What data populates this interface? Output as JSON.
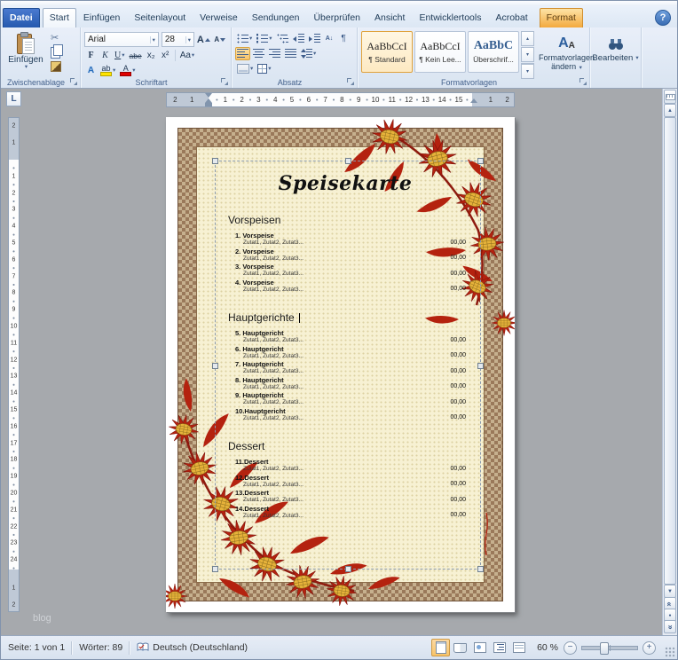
{
  "window": {
    "help": "?"
  },
  "icons": {
    "dropdown": "▾",
    "cut": "✂",
    "pilcrow": "¶",
    "sort": "A↓",
    "scroll_up": "▲",
    "scroll_down": "▼",
    "gallery_up": "▴",
    "gallery_down": "▾",
    "double_chevron": "«",
    "dot": "●",
    "style_a": "A",
    "minus": "−",
    "plus": "+",
    "tab_selector": "L"
  },
  "ribbon": {
    "tabs": [
      {
        "label": "Datei",
        "file": true
      },
      {
        "label": "Start",
        "active": true
      },
      {
        "label": "Einfügen"
      },
      {
        "label": "Seitenlayout"
      },
      {
        "label": "Verweise"
      },
      {
        "label": "Sendungen"
      },
      {
        "label": "Überprüfen"
      },
      {
        "label": "Ansicht"
      },
      {
        "label": "Entwicklertools"
      },
      {
        "label": "Acrobat"
      },
      {
        "label": "Format",
        "contextual": true
      }
    ],
    "clipboard": {
      "group": "Zwischenablage",
      "paste": "Einfügen"
    },
    "font": {
      "group": "Schriftart",
      "name": "Arial",
      "size": "28",
      "bold": "F",
      "italic": "K",
      "underline": "U",
      "strike": "abe",
      "sub": "x₂",
      "sup": "x²",
      "case": "Aa",
      "effects": "A",
      "highlight": "ab",
      "color": "A",
      "grow": "A",
      "shrink": "A"
    },
    "paragraph": {
      "group": "Absatz"
    },
    "styles": {
      "group": "Formatvorlagen",
      "gallery": [
        {
          "preview": "AaBbCcI",
          "label": "¶ Standard",
          "selected": true
        },
        {
          "preview": "AaBbCcI",
          "label": "¶ Kein Lee...",
          "selected": false
        },
        {
          "preview": "AaBbC",
          "label": "Überschrif...",
          "selected": false
        }
      ],
      "change": "Formatvorlagen ändern"
    },
    "editing": {
      "label": "Bearbeiten"
    }
  },
  "ruler": {
    "h_left": [
      "2",
      "1"
    ],
    "h_main": [
      "1",
      "2",
      "3",
      "4",
      "5",
      "6",
      "7",
      "8",
      "9",
      "10",
      "11",
      "12",
      "13",
      "14",
      "15"
    ],
    "h_right": [
      "1",
      "2"
    ],
    "v_top": [
      "2",
      "1"
    ],
    "v_main": [
      "1",
      "2",
      "3",
      "4",
      "5",
      "6",
      "7",
      "8",
      "9",
      "10",
      "11",
      "12",
      "13",
      "14",
      "15",
      "16",
      "17",
      "18",
      "19",
      "20",
      "21",
      "22",
      "23",
      "24"
    ],
    "v_bottom": [
      "1",
      "2"
    ]
  },
  "document": {
    "title": "Speisekarte",
    "sections": [
      {
        "heading": "Vorspeisen",
        "cursor": false,
        "items": [
          {
            "label": "1. Vorspeise",
            "ing": "Zutat1, Zutat2, Zutat3...",
            "price": "00,00"
          },
          {
            "label": "2. Vorspeise",
            "ing": "Zutat1, Zutat2, Zutat3...",
            "price": "00,00"
          },
          {
            "label": "3. Vorspeise",
            "ing": "Zutat1, Zutat2, Zutat3...",
            "price": "00,00"
          },
          {
            "label": "4. Vorspeise",
            "ing": "Zutat1, Zutat2, Zutat3...",
            "price": "00,00"
          }
        ]
      },
      {
        "heading": "Hauptgerichte",
        "cursor": true,
        "items": [
          {
            "label": "5. Hauptgericht",
            "ing": "Zutat1, Zutat2, Zutat3...",
            "price": "00,00"
          },
          {
            "label": "6. Hauptgericht",
            "ing": "Zutat1, Zutat2, Zutat3...",
            "price": "00,00"
          },
          {
            "label": "7. Hauptgericht",
            "ing": "Zutat1, Zutat2, Zutat3...",
            "price": "00,00"
          },
          {
            "label": "8. Hauptgericht",
            "ing": "Zutat1, Zutat2, Zutat3...",
            "price": "00,00"
          },
          {
            "label": "9. Hauptgericht",
            "ing": "Zutat1, Zutat2, Zutat3...",
            "price": "00,00"
          },
          {
            "label": "10.Hauptgericht",
            "ing": "Zutat1, Zutat2, Zutat3...",
            "price": "00,00"
          }
        ]
      },
      {
        "heading": "Dessert",
        "cursor": false,
        "items": [
          {
            "label": "11.Dessert",
            "ing": "Zutat1, Zutat2, Zutat3...",
            "price": "00,00"
          },
          {
            "label": "12.Dessert",
            "ing": "Zutat1, Zutat2, Zutat3...",
            "price": "00,00"
          },
          {
            "label": "13.Dessert",
            "ing": "Zutat1, Zutat2, Zutat3...",
            "price": "00,00"
          },
          {
            "label": "14.Dessert",
            "ing": "Zutat1, Zutat2, Zutat3...",
            "price": "00,00"
          }
        ]
      }
    ]
  },
  "canvas": {
    "watermark": "blog"
  },
  "status": {
    "page": "Seite: 1 von 1",
    "words": "Wörter: 89",
    "language": "Deutsch (Deutschland)",
    "zoom": "60 %"
  }
}
